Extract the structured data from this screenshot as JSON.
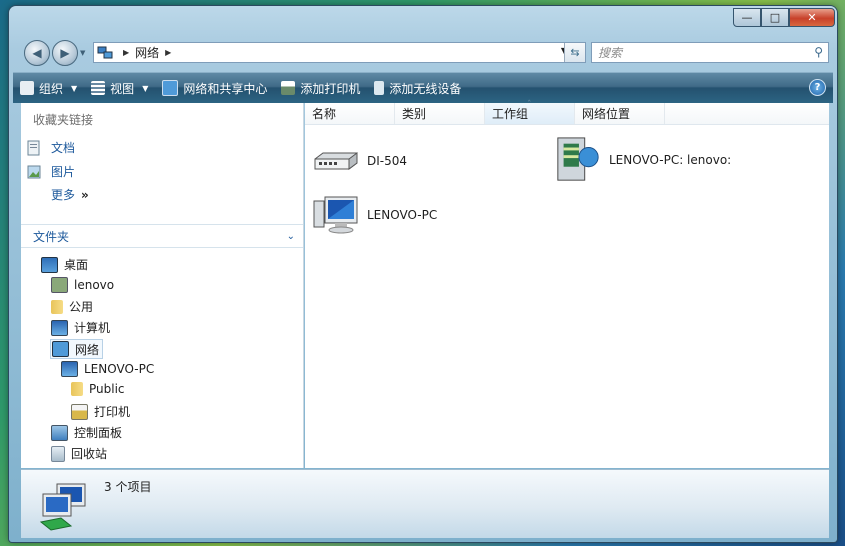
{
  "window": {
    "caption_buttons": [
      "minimize",
      "maximize",
      "close"
    ]
  },
  "address_bar": {
    "crumbs": [
      "网络"
    ],
    "search_placeholder": "搜索"
  },
  "toolbar": {
    "items": [
      {
        "label": "组织",
        "icon": "organize-icon",
        "has_dropdown": true
      },
      {
        "label": "视图",
        "icon": "views-icon",
        "has_dropdown": true
      },
      {
        "label": "网络和共享中心",
        "icon": "network-center-icon"
      },
      {
        "label": "添加打印机",
        "icon": "printer-icon"
      },
      {
        "label": "添加无线设备",
        "icon": "wireless-device-icon"
      }
    ]
  },
  "favorites": {
    "header": "收藏夹链接",
    "items": [
      "文档",
      "图片",
      "更多"
    ]
  },
  "folders": {
    "header": "文件夹",
    "tree": [
      {
        "label": "桌面",
        "level": 0
      },
      {
        "label": "lenovo",
        "level": 1
      },
      {
        "label": "公用",
        "level": 1
      },
      {
        "label": "计算机",
        "level": 1
      },
      {
        "label": "网络",
        "level": 1,
        "selected": true
      },
      {
        "label": "LENOVO-PC",
        "level": 2
      },
      {
        "label": "Public",
        "level": 3
      },
      {
        "label": "打印机",
        "level": 3
      },
      {
        "label": "控制面板",
        "level": 1
      },
      {
        "label": "回收站",
        "level": 1
      }
    ]
  },
  "columns": [
    "名称",
    "类别",
    "工作组",
    "网络位置"
  ],
  "sorted_column": "工作组",
  "items": [
    {
      "label": "DI-504",
      "icon": "router-icon"
    },
    {
      "label": "LENOVO-PC: lenovo:",
      "icon": "media-device-icon"
    },
    {
      "label": "LENOVO-PC",
      "icon": "computer-icon"
    }
  ],
  "status": {
    "count_text": "3 个项目"
  },
  "colors": {
    "link": "#1e5a9c",
    "toolbar_top": "#5f8aa5",
    "toolbar_bottom": "#24516f"
  }
}
